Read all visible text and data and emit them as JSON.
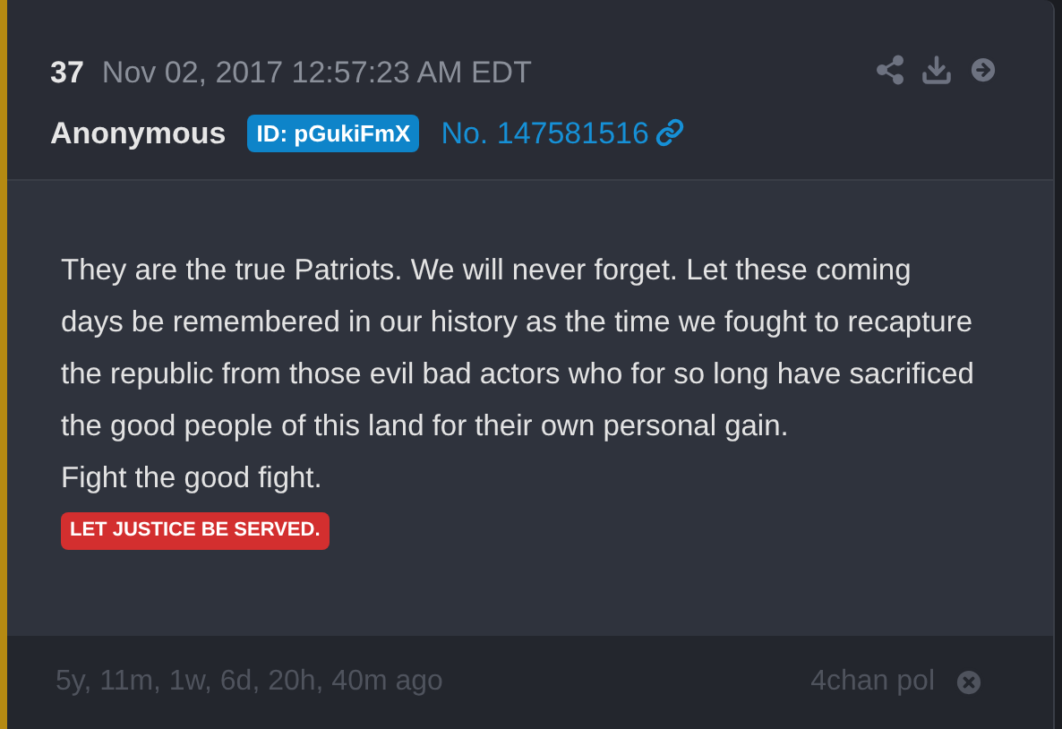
{
  "post": {
    "number": "37",
    "timestamp": "Nov 02, 2017 12:57:23 AM EDT",
    "author": "Anonymous",
    "id_badge": "ID: pGukiFmX",
    "post_no": "No. 147581516",
    "paragraphs": [
      "They are the true Patriots. We will never forget. Let these coming days be remembered in our history as the time we fought to recapture the republic from those evil bad actors who for so long have sacrificed the good people of this land for their own personal gain.",
      "Fight the good fight."
    ],
    "tag": "LET JUSTICE BE SERVED.",
    "age": "5y, 11m, 1w, 6d, 20h, 40m ago",
    "source": "4chan pol"
  }
}
